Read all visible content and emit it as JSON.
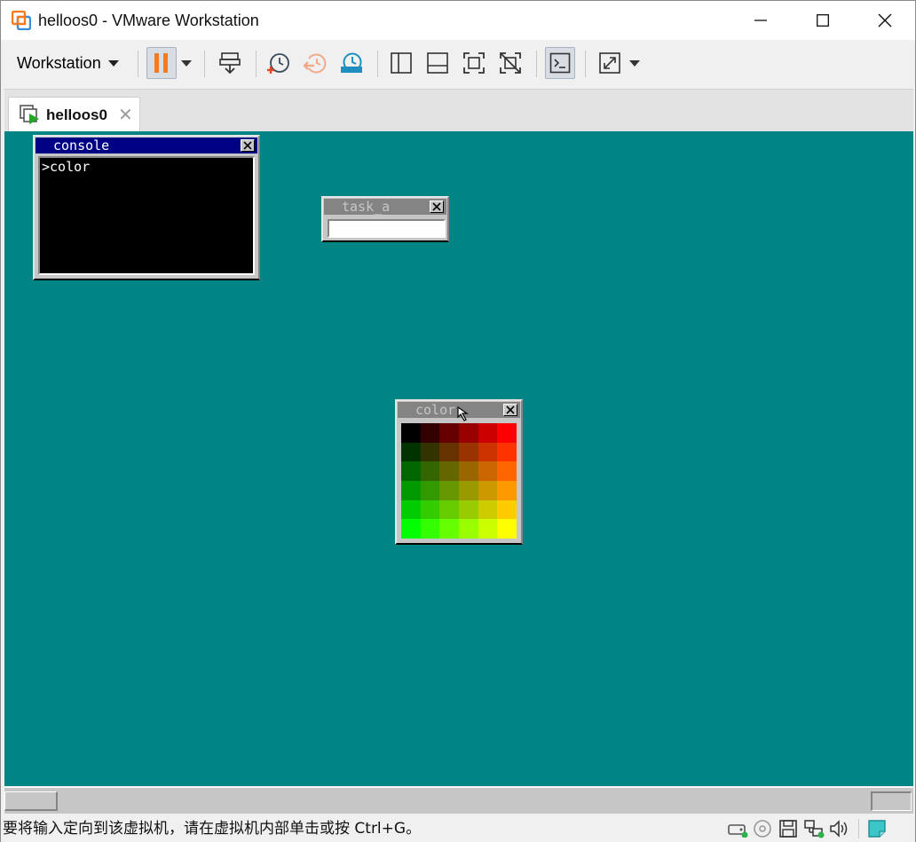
{
  "window": {
    "title": "helloos0 - VMware Workstation"
  },
  "toolbar": {
    "workstation_menu_label": "Workstation"
  },
  "tab": {
    "label": "helloos0",
    "close_glyph": "✕"
  },
  "guest": {
    "background_color": "#008484",
    "console": {
      "title": "console",
      "text": ">color",
      "active": true
    },
    "task_a": {
      "title": "task_a"
    },
    "color_window": {
      "title": "color",
      "palette": [
        [
          "#000000",
          "#330000",
          "#660000",
          "#990000",
          "#cc0000",
          "#ff0000"
        ],
        [
          "#003300",
          "#333300",
          "#663300",
          "#993300",
          "#cc3300",
          "#ff3300"
        ],
        [
          "#006600",
          "#336600",
          "#666600",
          "#996600",
          "#cc6600",
          "#ff6600"
        ],
        [
          "#009900",
          "#339900",
          "#669900",
          "#999900",
          "#cc9900",
          "#ff9900"
        ],
        [
          "#00cc00",
          "#33cc00",
          "#66cc00",
          "#99cc00",
          "#cccc00",
          "#ffcc00"
        ],
        [
          "#00ff00",
          "#33ff00",
          "#66ff00",
          "#99ff00",
          "#ccff00",
          "#ffff00"
        ]
      ]
    }
  },
  "statusbar": {
    "message": "要将输入定向到该虚拟机，请在虚拟机内部单击或按 Ctrl+G。",
    "icons": [
      "hard-disk-icon",
      "cd-dvd-icon",
      "floppy-icon",
      "network-adapter-icon",
      "sound-icon",
      "message-log-icon"
    ]
  },
  "colors": {
    "os_active_title": "#000084",
    "os_inactive_title": "#848484",
    "os_window_face": "#c6c6c6",
    "vmware_accent_orange": "#f47b20"
  }
}
